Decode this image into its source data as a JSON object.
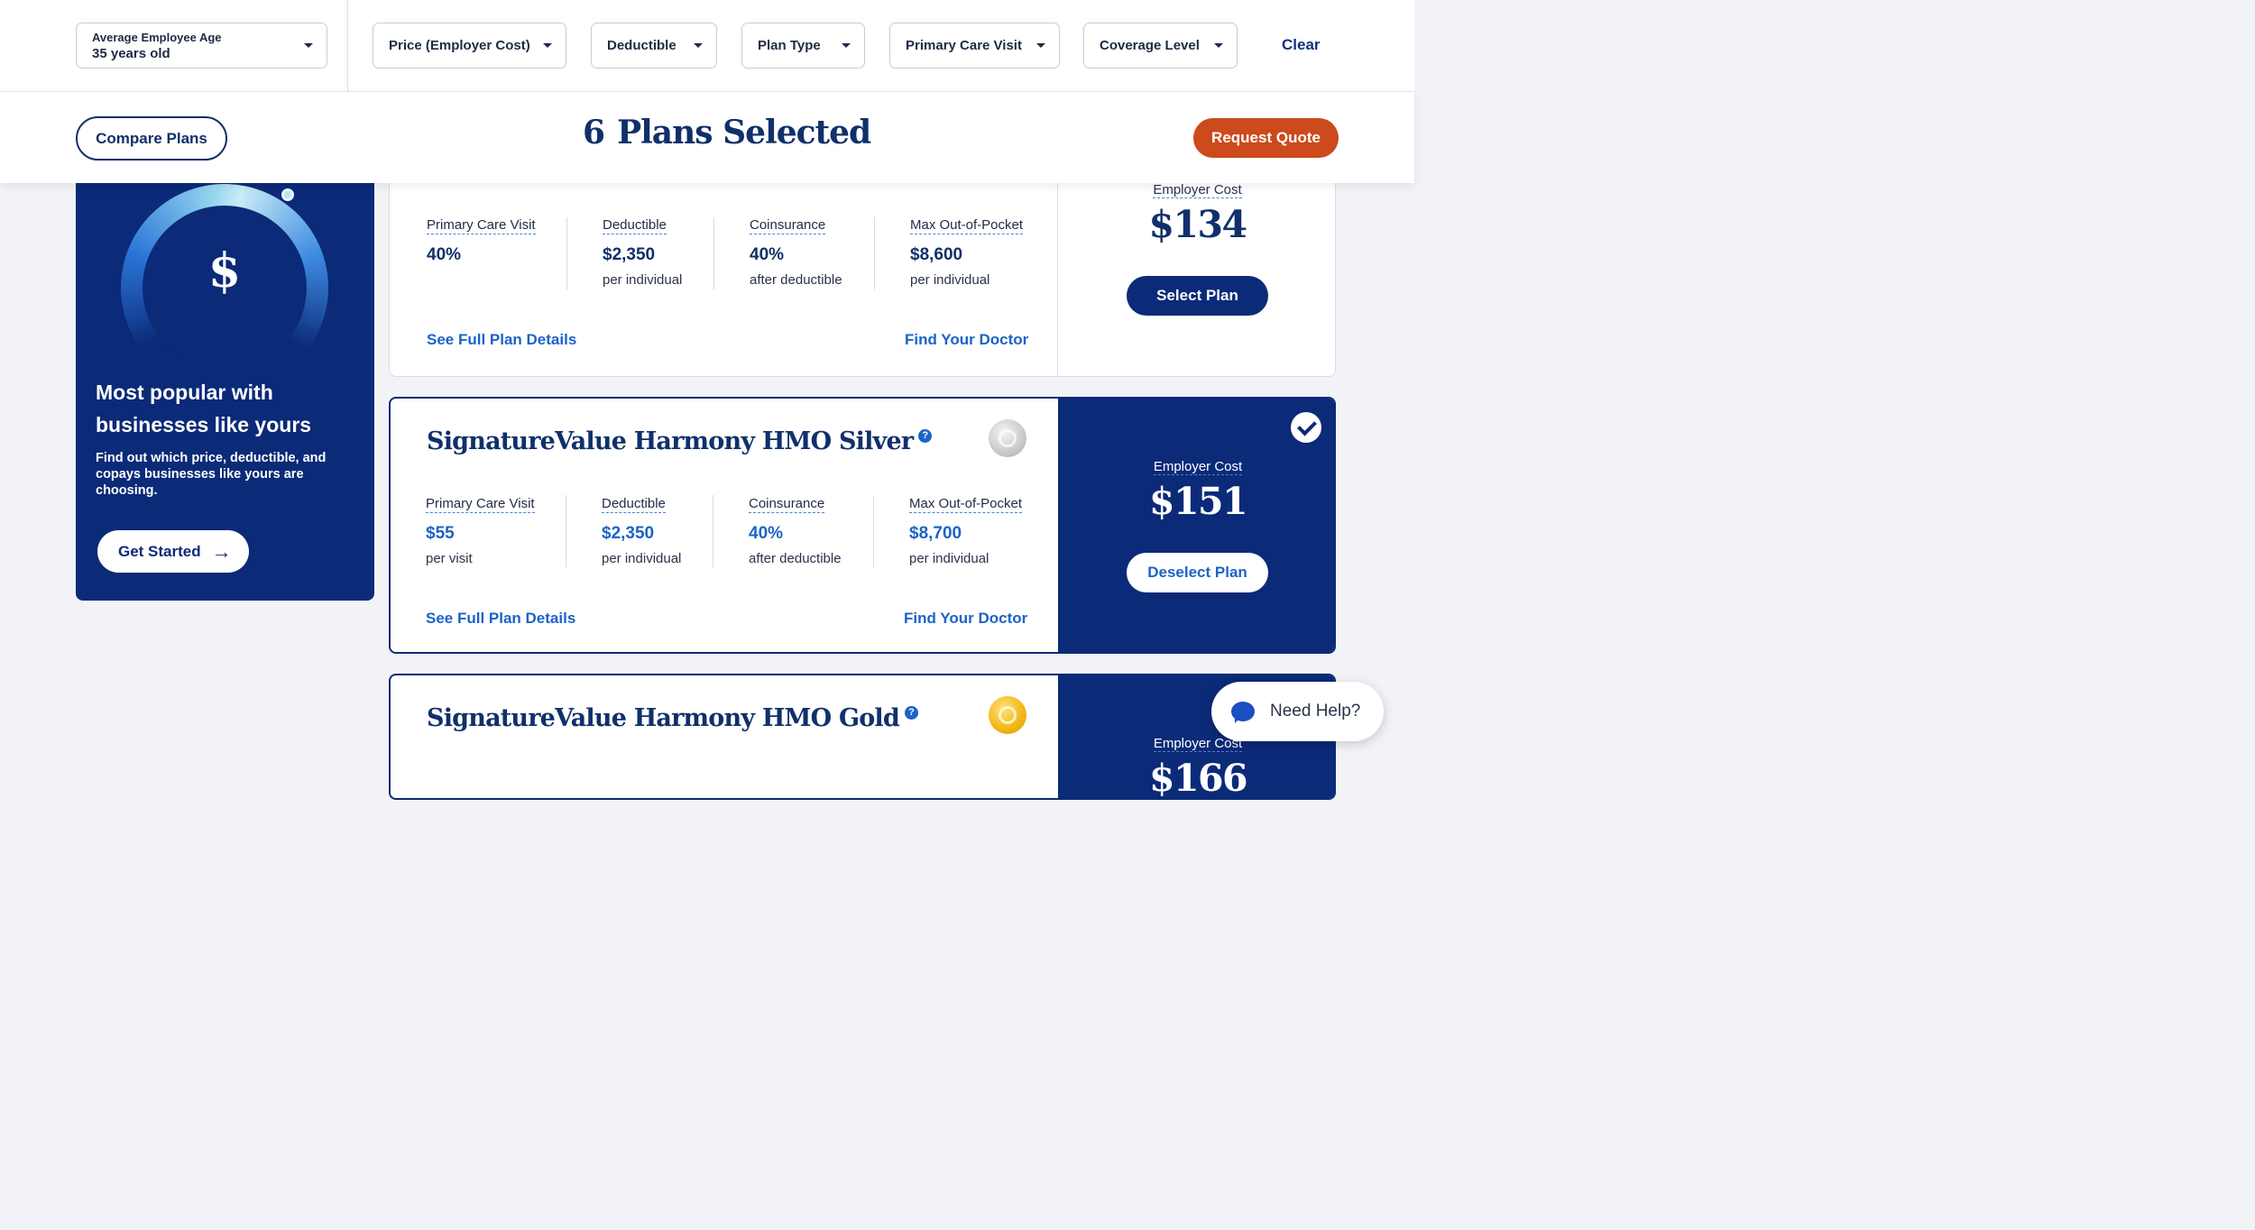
{
  "filters": {
    "age_label": "Average Employee Age",
    "age_value": "35 years old",
    "price": "Price (Employer Cost)",
    "deductible": "Deductible",
    "plan_type": "Plan Type",
    "primary_care": "Primary Care Visit",
    "coverage": "Coverage Level",
    "clear": "Clear"
  },
  "header": {
    "compare": "Compare Plans",
    "count": "6",
    "selected_text": "Plans Selected",
    "quote": "Request Quote"
  },
  "promo": {
    "dollar": "$",
    "title": "Most popular with businesses like yours",
    "desc": "Find out which price, deductible, and copays businesses like yours are choosing.",
    "button": "Get Started",
    "arrow": "→"
  },
  "labels": {
    "primary_care": "Primary Care Visit",
    "deductible": "Deductible",
    "coinsurance": "Coinsurance",
    "max_oop": "Max Out-of-Pocket",
    "see_details": "See Full Plan Details",
    "find_doctor": "Find Your Doctor",
    "employer_cost": "Employer Cost"
  },
  "plans": [
    {
      "name": "",
      "pcv": "40%",
      "pcv_sub": "",
      "deductible": "$2,350",
      "deductible_sub": "per individual",
      "coinsurance": "40%",
      "coinsurance_sub": "after deductible",
      "max_oop": "$8,600",
      "max_oop_sub": "per individual",
      "price": "$134",
      "action": "Select Plan",
      "selected": false
    },
    {
      "name": "SignatureValue Harmony HMO Silver",
      "tier": "silver",
      "pcv": "$55",
      "pcv_sub": "per visit",
      "deductible": "$2,350",
      "deductible_sub": "per individual",
      "coinsurance": "40%",
      "coinsurance_sub": "after deductible",
      "max_oop": "$8,700",
      "max_oop_sub": "per individual",
      "price": "$151",
      "action": "Deselect Plan",
      "selected": true
    },
    {
      "name": "SignatureValue Harmony HMO Gold",
      "tier": "gold",
      "price": "$166"
    }
  ],
  "help": {
    "label": "Need Help?"
  },
  "colors": {
    "navy": "#0b2a78",
    "accent_blue": "#1b63c8",
    "quote_orange": "#cc4a1c"
  },
  "icons": [
    "caret-down-icon",
    "dollar-icon",
    "arrow-right-icon",
    "info-icon",
    "silver-tier-icon",
    "gold-tier-icon",
    "checkmark-icon",
    "chat-icon"
  ]
}
